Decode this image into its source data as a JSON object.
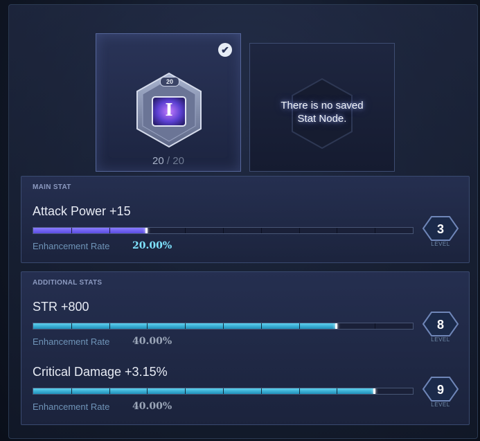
{
  "slots": {
    "active": {
      "badge": "20",
      "glyph": "I",
      "count_current": "20",
      "count_sep": " / ",
      "count_max": "20",
      "check_icon": "✔"
    },
    "empty": {
      "line1": "There is no saved",
      "line2": "Stat Node."
    }
  },
  "main_stat": {
    "section_title": "MAIN STAT",
    "stat": "Attack Power +15",
    "progress": 0.3,
    "rate_label": "Enhancement Rate",
    "rate_value": "20.00%",
    "level": "3",
    "level_word": "LEVEL"
  },
  "additional_stats": {
    "section_title": "ADDITIONAL STATS",
    "items": [
      {
        "stat": "STR +800",
        "progress": 0.8,
        "rate_label": "Enhancement Rate",
        "rate_value": "40.00%",
        "level": "8",
        "level_word": "LEVEL"
      },
      {
        "stat": "Critical Damage +3.15%",
        "progress": 0.9,
        "rate_label": "Enhancement Rate",
        "rate_value": "40.00%",
        "level": "9",
        "level_word": "LEVEL"
      }
    ]
  },
  "colors": {
    "main_bar": "#6a5cf0",
    "additional_bar": "#2fb4dc",
    "highlight_rate": "#7fe3ff"
  }
}
